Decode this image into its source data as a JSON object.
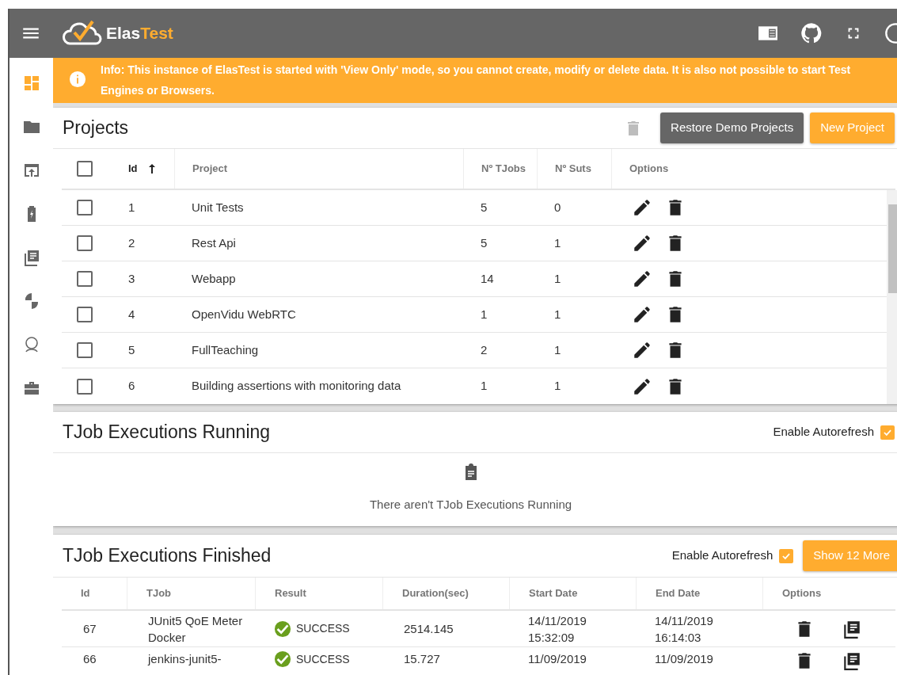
{
  "header": {
    "logo_plain": "Elas",
    "logo_accent": "Test"
  },
  "sidebar": {
    "items": [
      {
        "selected": true
      },
      {
        "selected": false
      },
      {
        "selected": false
      },
      {
        "selected": false
      },
      {
        "selected": false
      },
      {
        "selected": false
      },
      {
        "selected": false
      },
      {
        "selected": false
      }
    ]
  },
  "banner": {
    "text": "Info: This instance of ElasTest is started with 'View Only' mode, so you cannot create, modify or delete data. It is also not possible to start Test Engines or Browsers."
  },
  "projects": {
    "title": "Projects",
    "bulk_delete": {
      "disabled": true
    },
    "buttons": [
      {
        "label": "Restore Demo Projects",
        "kind": "dark"
      },
      {
        "label": "New Project",
        "kind": "accent"
      }
    ],
    "select_all": {
      "checked": false
    },
    "columns": [
      {
        "label": "Id",
        "sorted": true
      },
      {
        "label": "Project"
      },
      {
        "label": "Nº TJobs"
      },
      {
        "label": "Nº Suts"
      },
      {
        "label": "Options"
      }
    ],
    "rows": [
      {
        "checked": false,
        "id": "1",
        "project": "Unit Tests",
        "tjobs": "5",
        "suts": "0"
      },
      {
        "checked": false,
        "id": "2",
        "project": "Rest Api",
        "tjobs": "5",
        "suts": "1"
      },
      {
        "checked": false,
        "id": "3",
        "project": "Webapp",
        "tjobs": "14",
        "suts": "1"
      },
      {
        "checked": false,
        "id": "4",
        "project": "OpenVidu WebRTC",
        "tjobs": "1",
        "suts": "1"
      },
      {
        "checked": false,
        "id": "5",
        "project": "FullTeaching",
        "tjobs": "2",
        "suts": "1"
      },
      {
        "checked": false,
        "id": "6",
        "project": "Building assertions with monitoring data",
        "tjobs": "1",
        "suts": "1"
      }
    ]
  },
  "running": {
    "title": "TJob Executions Running",
    "autorefresh": {
      "label": "Enable Autorefresh",
      "checked": true
    },
    "empty_message": "There aren't TJob Executions Running"
  },
  "finished": {
    "title": "TJob Executions Finished",
    "autorefresh": {
      "label": "Enable Autorefresh",
      "checked": true
    },
    "button": "Show 12 More",
    "columns": [
      "Id",
      "TJob",
      "Result",
      "Duration(sec)",
      "Start Date",
      "End Date",
      "Options"
    ],
    "rows": [
      {
        "id": "67",
        "tjob": "JUnit5 QoE Meter Docker",
        "success": true,
        "result": "SUCCESS",
        "duration": "2514.145",
        "start_date": "14/11/2019",
        "start_time": "15:32:09",
        "end_date": "14/11/2019",
        "end_time": "16:14:03"
      },
      {
        "id": "66",
        "tjob": "jenkins-junit5-",
        "success": true,
        "result": "SUCCESS",
        "duration": "15.727",
        "start_date": "11/09/2019",
        "end_date": "11/09/2019"
      }
    ]
  }
}
